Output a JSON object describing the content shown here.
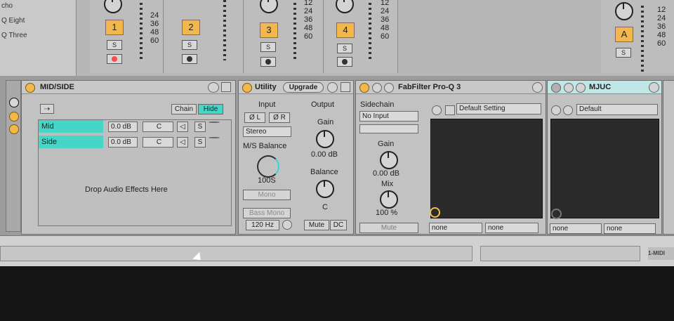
{
  "mixer": {
    "sends": [
      "cho",
      "Q Eight",
      "Q Three"
    ],
    "tracks": [
      {
        "number": "1",
        "solo": "S",
        "rec_color": "#ff4b4b"
      },
      {
        "number": "2",
        "solo": "S",
        "rec_color": "#d8d8d8"
      },
      {
        "number": "3",
        "solo": "S",
        "rec_color": "#d8d8d8"
      },
      {
        "number": "4",
        "solo": "S",
        "rec_color": "#d8d8d8"
      }
    ],
    "return_track": {
      "letter": "A",
      "solo": "S"
    },
    "meter_scale": [
      "12",
      "24",
      "36",
      "48",
      "60"
    ],
    "meter_scale_right": [
      "12",
      "24",
      "36",
      "48",
      "60"
    ]
  },
  "devices": {
    "midside": {
      "title": "MID/SIDE",
      "chain_label": "Chain",
      "hide_label": "Hide",
      "rows": [
        {
          "name": "Mid",
          "level": "0.0 dB",
          "pan": "C",
          "solo": "S"
        },
        {
          "name": "Side",
          "level": "0.0 dB",
          "pan": "C",
          "solo": "S"
        }
      ],
      "drop_text": "Drop Audio Effects Here"
    },
    "utility": {
      "title": "Utility",
      "upgrade": "Upgrade",
      "input_label": "Input",
      "output_label": "Output",
      "phase_l": "Ø L",
      "phase_r": "Ø R",
      "mode": "Stereo",
      "ms_balance": "M/S Balance",
      "ms_value": "100S",
      "mono": "Mono",
      "bass_mono": "Bass Mono",
      "freq": "120 Hz",
      "gain_label": "Gain",
      "gain_value": "0.00 dB",
      "balance_label": "Balance",
      "balance_value": "C",
      "mute": "Mute",
      "dc": "DC"
    },
    "proq": {
      "title": "FabFilter Pro-Q 3",
      "sidechain": "Sidechain",
      "no_input": "No Input",
      "gain_label": "Gain",
      "gain_value": "0.00 dB",
      "mix_label": "Mix",
      "mix_value": "100 %",
      "mute": "Mute",
      "preset": "Default Setting",
      "select_1": "none",
      "select_2": "none"
    },
    "mjuc": {
      "title": "MJUC",
      "preset": "Default",
      "select_1": "none",
      "select_2": "none"
    }
  },
  "status": {
    "midi_label": "1-MIDI"
  }
}
